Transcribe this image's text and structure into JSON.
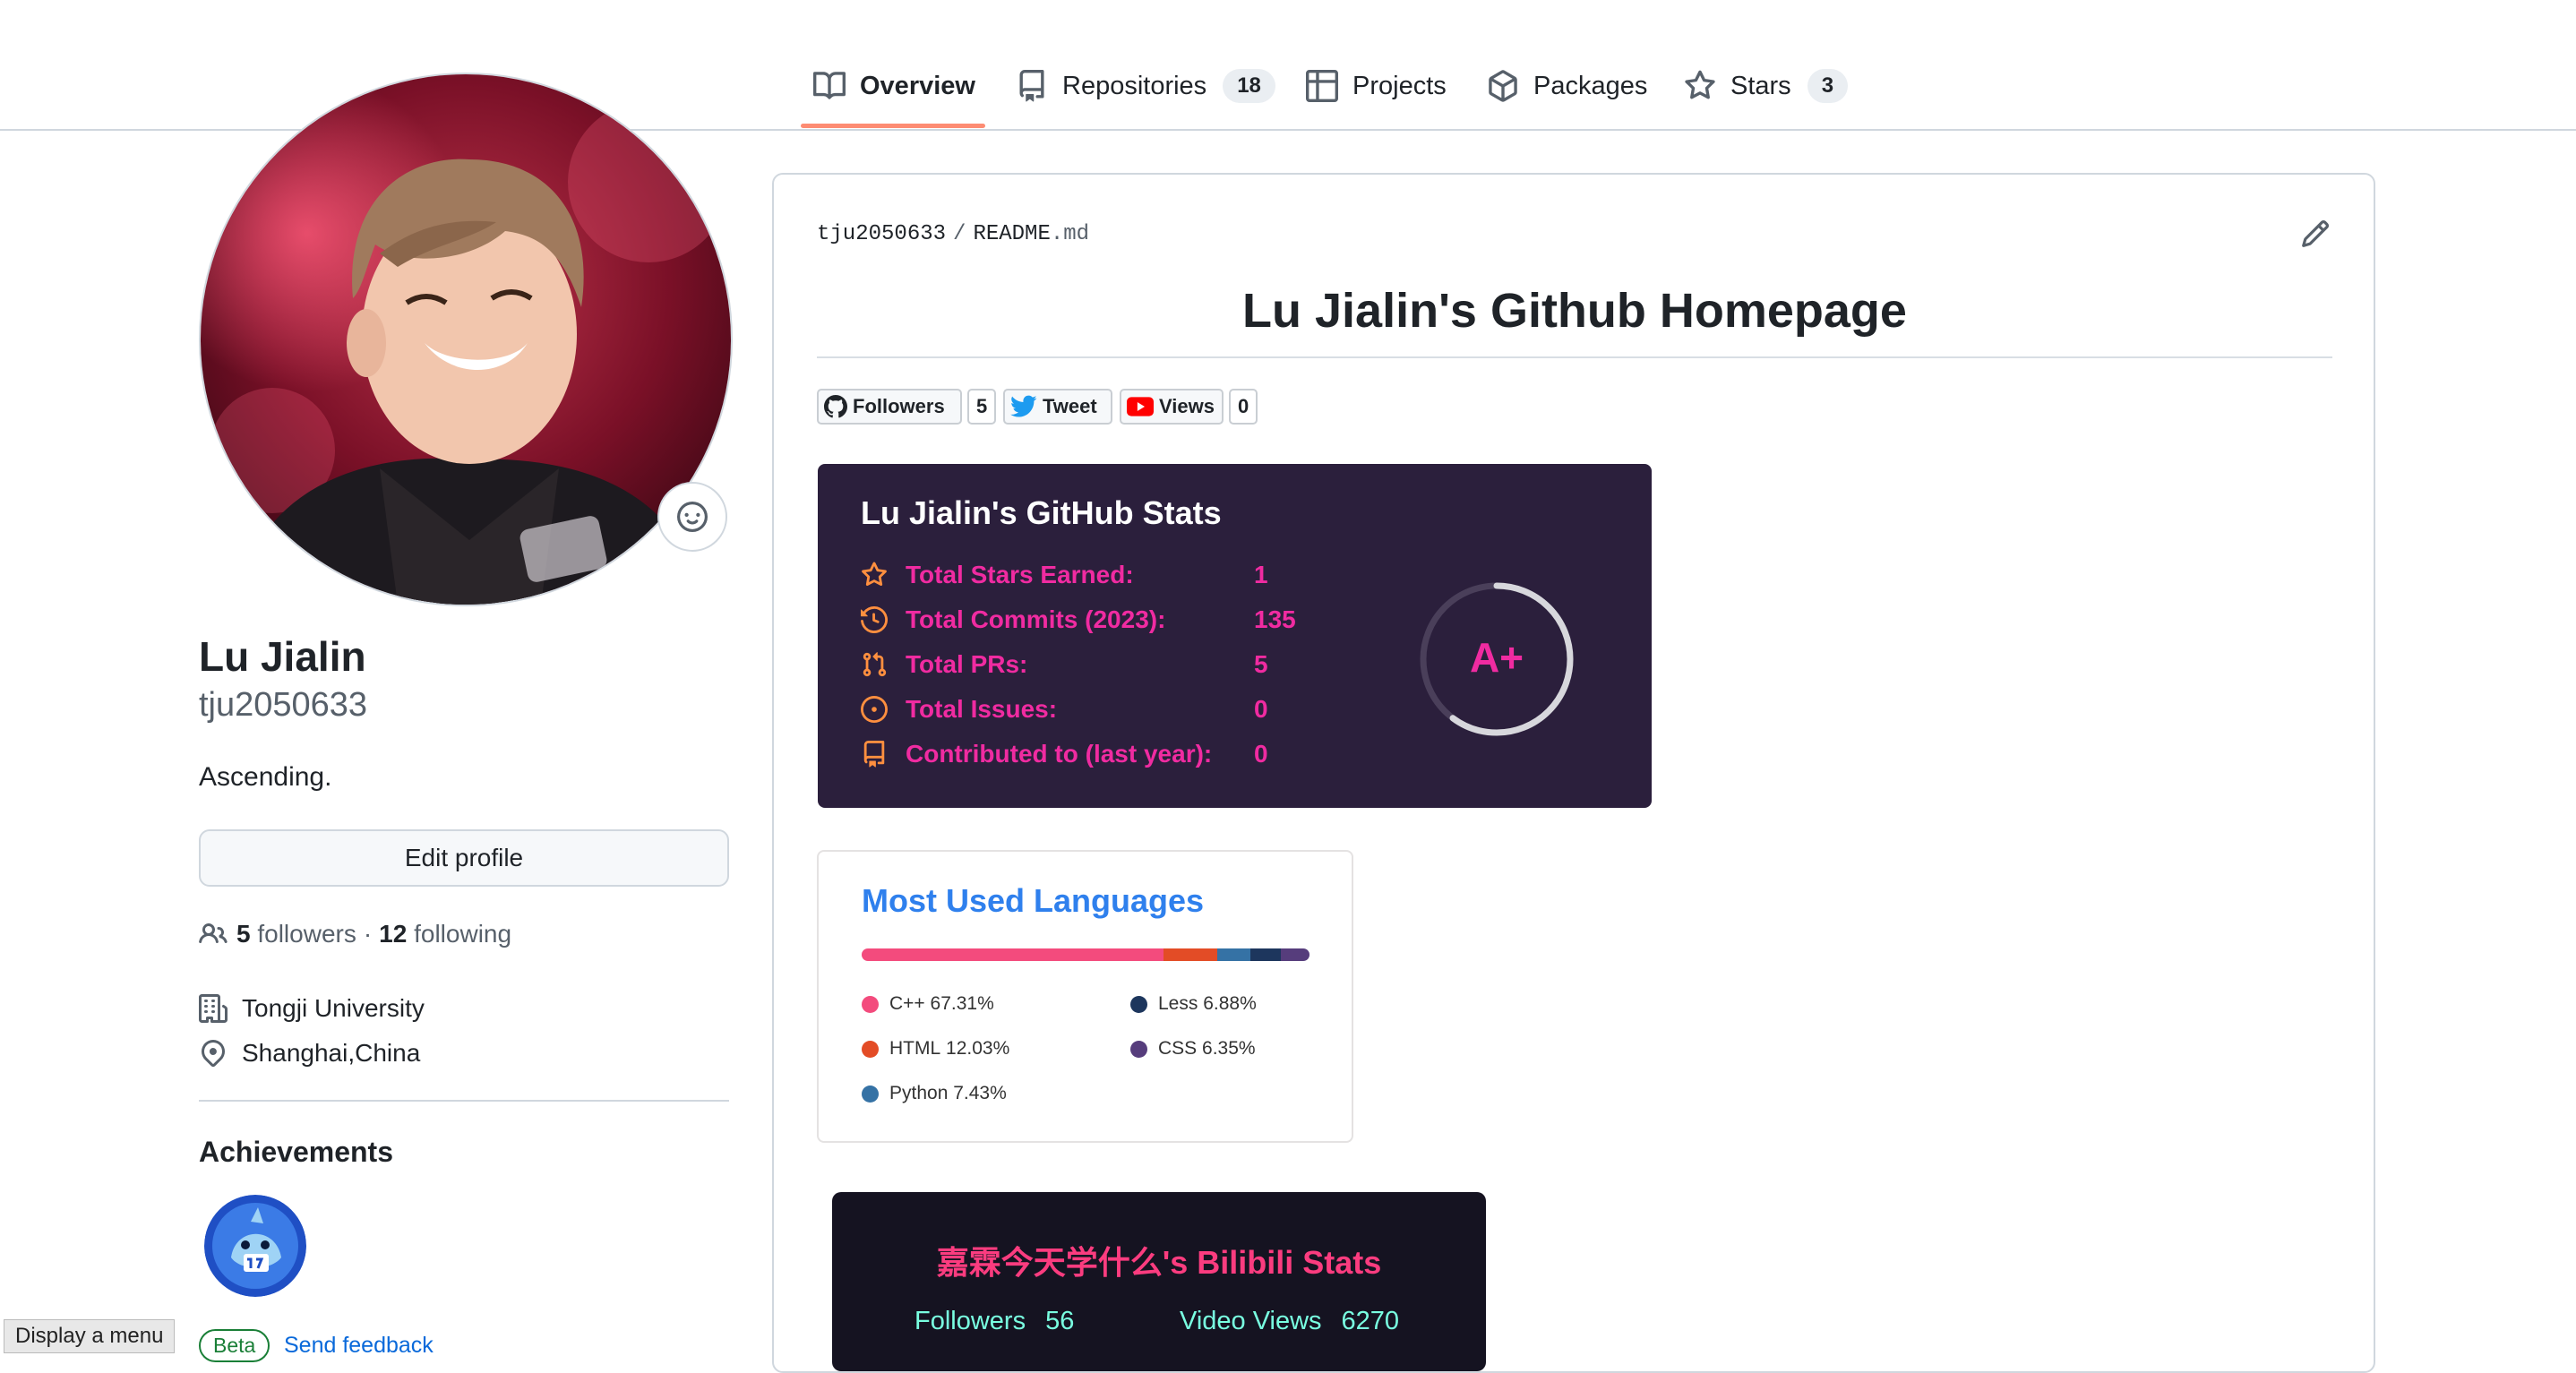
{
  "nav": {
    "tabs": [
      {
        "label": "Overview",
        "icon": "book-icon"
      },
      {
        "label": "Repositories",
        "icon": "repo-icon",
        "count": "18"
      },
      {
        "label": "Projects",
        "icon": "table-icon"
      },
      {
        "label": "Packages",
        "icon": "package-icon"
      },
      {
        "label": "Stars",
        "icon": "star-icon",
        "count": "3"
      }
    ],
    "active": "Overview",
    "accent": "#fd8c73"
  },
  "profile": {
    "name": "Lu Jialin",
    "login": "tju2050633",
    "bio": "Ascending.",
    "edit_label": "Edit profile",
    "followers_count": "5",
    "followers_label": "followers",
    "separator": "·",
    "following_count": "12",
    "following_label": "following",
    "organization": "Tongji University",
    "location": "Shanghai,China",
    "achievements_title": "Achievements",
    "beta_label": "Beta",
    "feedback_label": "Send feedback"
  },
  "tooltip": {
    "label": "Display a menu"
  },
  "readme": {
    "path_owner": "tju2050633",
    "path_sep": "/",
    "path_file": "README",
    "path_ext": ".md",
    "title": "Lu Jialin's Github Homepage",
    "badges": {
      "followers_label": "Followers",
      "followers_count": "5",
      "tweet_label": "Tweet",
      "views_label": "Views",
      "views_count": "0"
    },
    "stats": {
      "title": "Lu Jialin's GitHub Stats",
      "accent": "#f02ba1",
      "icon_color": "#ff8f3f",
      "background": "#2b1f3c",
      "rows": [
        {
          "label": "Total Stars Earned:",
          "value": "1",
          "icon": "star-icon"
        },
        {
          "label": "Total Commits (2023):",
          "value": "135",
          "icon": "history-icon"
        },
        {
          "label": "Total PRs:",
          "value": "5",
          "icon": "pull-request-icon"
        },
        {
          "label": "Total Issues:",
          "value": "0",
          "icon": "issue-icon"
        },
        {
          "label": "Contributed to (last year):",
          "value": "0",
          "icon": "repo-icon"
        }
      ],
      "grade": "A+"
    },
    "languages": {
      "title": "Most Used Languages",
      "items": [
        {
          "name": "C++",
          "percent": "67.31%",
          "value": 67.31,
          "color": "#f34b7d"
        },
        {
          "name": "HTML",
          "percent": "12.03%",
          "value": 12.03,
          "color": "#e34c26"
        },
        {
          "name": "Python",
          "percent": "7.43%",
          "value": 7.43,
          "color": "#3572a5"
        },
        {
          "name": "Less",
          "percent": "6.88%",
          "value": 6.88,
          "color": "#1d365d"
        },
        {
          "name": "CSS",
          "percent": "6.35%",
          "value": 6.35,
          "color": "#563d7c"
        }
      ]
    },
    "bilibili": {
      "title": "嘉霖今天学什么's Bilibili Stats",
      "followers_label": "Followers",
      "followers_value": "56",
      "views_label": "Video Views",
      "views_value": "6270"
    }
  }
}
